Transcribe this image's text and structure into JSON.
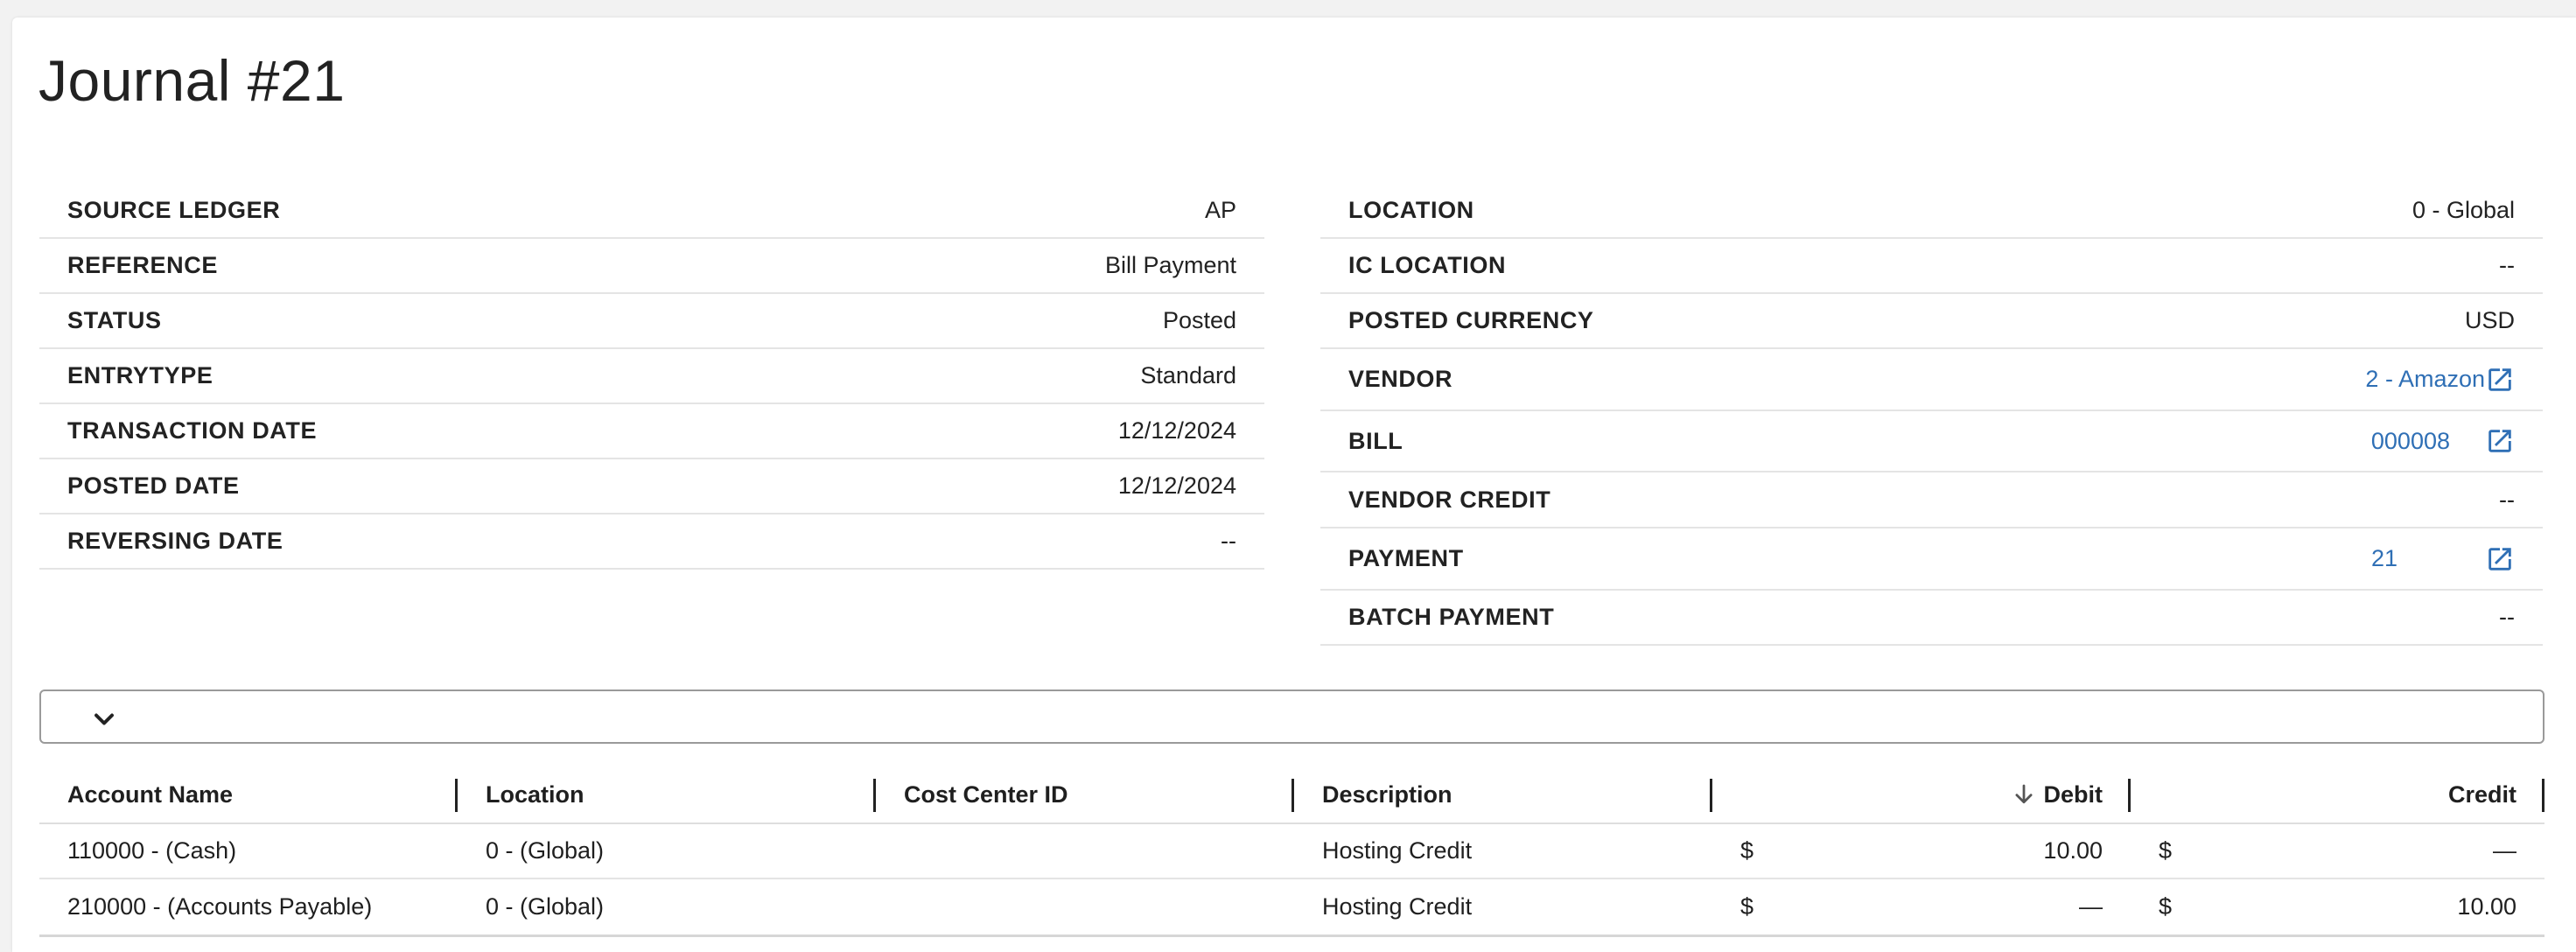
{
  "title": "Journal #21",
  "details_left": [
    {
      "label": "SOURCE LEDGER",
      "value": "AP"
    },
    {
      "label": "REFERENCE",
      "value": "Bill Payment"
    },
    {
      "label": "STATUS",
      "value": "Posted"
    },
    {
      "label": "ENTRYTYPE",
      "value": "Standard"
    },
    {
      "label": "TRANSACTION DATE",
      "value": "12/12/2024"
    },
    {
      "label": "POSTED DATE",
      "value": "12/12/2024"
    },
    {
      "label": "REVERSING DATE",
      "value": "--"
    }
  ],
  "details_right": {
    "location": {
      "label": "LOCATION",
      "value": "0 - Global"
    },
    "ic_location": {
      "label": "IC LOCATION",
      "value": "--"
    },
    "posted_currency": {
      "label": "POSTED CURRENCY",
      "value": "USD"
    },
    "vendor": {
      "label": "VENDOR",
      "value": "2 - Amazon",
      "icon": "external-link-icon"
    },
    "bill": {
      "label": "BILL",
      "value": "000008",
      "icon": "external-link-icon"
    },
    "vendor_credit": {
      "label": "VENDOR CREDIT",
      "value": "--"
    },
    "payment": {
      "label": "PAYMENT",
      "value": "21",
      "icon": "external-link-icon"
    },
    "batch_payment": {
      "label": "BATCH PAYMENT",
      "value": "--"
    }
  },
  "toolbar": {
    "expand_icon": "chevron-down-icon"
  },
  "table": {
    "columns": [
      "Account Name",
      "Location",
      "Cost Center ID",
      "Description",
      "Debit",
      "Credit"
    ],
    "sort": {
      "column": "Debit",
      "direction": "descending",
      "icon": "arrow-down-icon"
    },
    "rows": [
      {
        "account_name": "110000 - (Cash)",
        "location": "0 - (Global)",
        "cost_center_id": "",
        "description": "Hosting Credit",
        "debit_currency": "$",
        "debit": "10.00",
        "credit_currency": "$",
        "credit": "—"
      },
      {
        "account_name": "210000 - (Accounts Payable)",
        "location": "0 - (Global)",
        "cost_center_id": "",
        "description": "Hosting Credit",
        "debit_currency": "$",
        "debit": "—",
        "credit_currency": "$",
        "credit": "10.00"
      }
    ]
  },
  "colors": {
    "link": "#2f6fb5",
    "text": "#222222",
    "divider": "#e4e4e4"
  }
}
